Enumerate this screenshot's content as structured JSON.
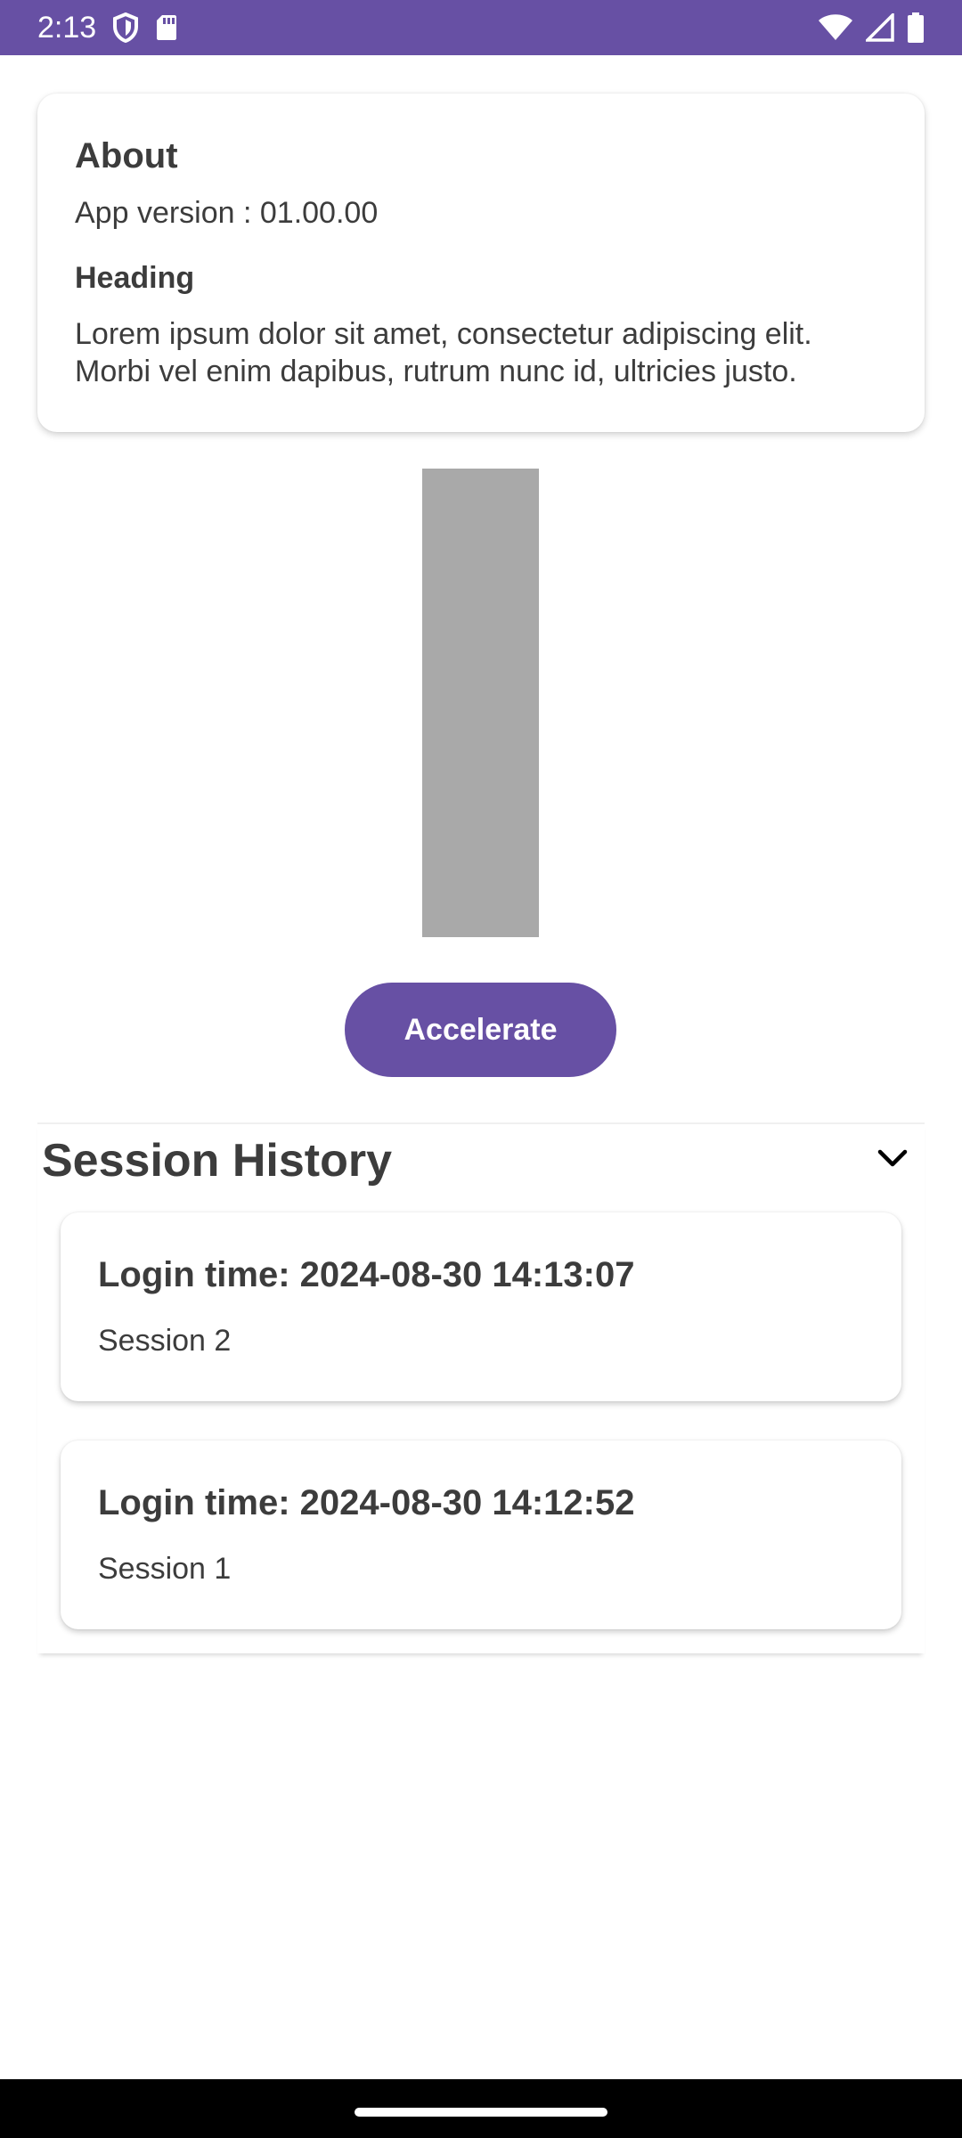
{
  "status_bar": {
    "time": "2:13",
    "icons": [
      "shield-icon",
      "sd-card-icon",
      "wifi-icon",
      "signal-icon",
      "battery-icon"
    ],
    "background": "#6750a4"
  },
  "about": {
    "title": "About",
    "version": "App version : 01.00.00",
    "heading": "Heading",
    "body": "Lorem ipsum dolor sit amet, consectetur adipiscing elit. Morbi vel enim dapibus, rutrum nunc id, ultricies justo."
  },
  "gauge": {
    "level_percent": 100,
    "fill_color": "#a9a9a9"
  },
  "accelerate_button": {
    "label": "Accelerate",
    "color": "#6750a4"
  },
  "session_history": {
    "title": "Session History",
    "expanded": true,
    "sessions": [
      {
        "login": "Login time: 2024-08-30 14:13:07",
        "name": "Session 2"
      },
      {
        "login": "Login time: 2024-08-30 14:12:52",
        "name": "Session 1"
      }
    ]
  }
}
